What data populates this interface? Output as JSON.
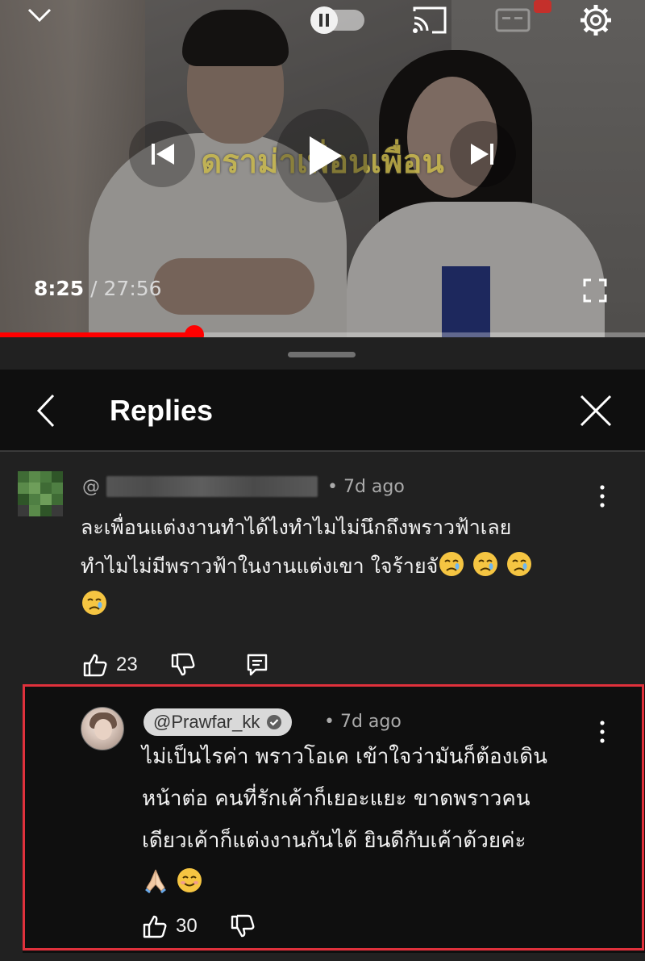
{
  "player": {
    "overlay_title": "ดราม่าเพื่อนเพื่อน",
    "current_time": "8:25",
    "separator": " / ",
    "duration": "27:56",
    "progress_fraction": 0.301,
    "icons": [
      "chevron-down-icon",
      "autoplay-toggle-icon",
      "cast-icon",
      "captions-icon",
      "settings-gear-icon",
      "previous-icon",
      "play-icon",
      "next-icon",
      "fullscreen-icon"
    ],
    "accent_color": "#ff0000"
  },
  "sheet": {
    "title": "Replies"
  },
  "parent_comment": {
    "handle_prefix": "@",
    "age": "• 7d ago",
    "text_line1": "ละเพื่อนแต่งงานทำได้ไงทำไมไม่นึกถึงพราวฟ้าเลย",
    "text_line2": "ทำไมไม่มีพราวฟ้าในงานแต่งเขา ใจร้ายจั",
    "emoji": "crying-face",
    "likes": "23"
  },
  "reply": {
    "handle": "@Prawfar_kk",
    "age": "• 7d ago",
    "text_line1": "ไม่เป็นไรค่า พราวโอเค เข้าใจว่ามันก็ต้องเดิน",
    "text_line2": "หน้าต่อ คนที่รักเค้าก็เยอะแยะ ขาดพราวคน",
    "text_line3": "เดียวเค้าก็แต่งงานกันได้ ยินดีกับเค้าด้วยค่ะ",
    "emojis": [
      "folded-hands",
      "smiling-face"
    ],
    "likes": "30",
    "highlight_color": "#e0313c"
  }
}
